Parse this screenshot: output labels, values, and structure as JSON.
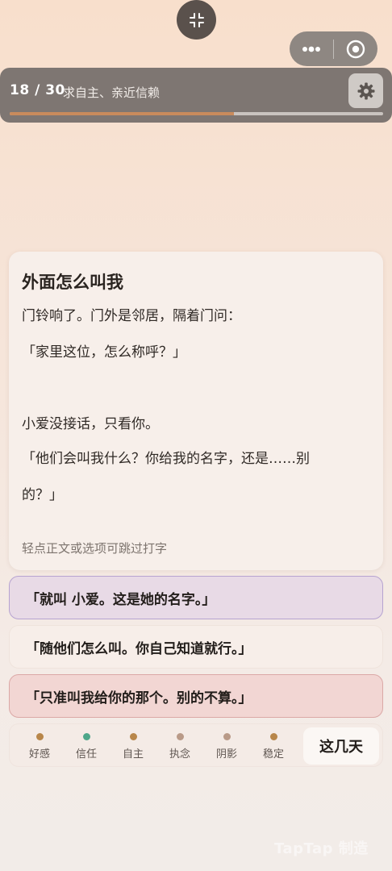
{
  "header": {
    "progress_count": "18 / 30",
    "progress_fraction": 0.6,
    "subtitle": "求自主、亲近信赖"
  },
  "story": {
    "title": "外面怎么叫我",
    "lines": [
      "门铃响了。门外是邻居，隔着门问：",
      "「家里这位，怎么称呼？」",
      "小爱没接话，只看你。",
      "「他们会叫我什么？你给我的名字，还是……别",
      "的？」"
    ],
    "hint": "轻点正文或选项可跳过打字"
  },
  "choices": [
    "「就叫 小爱。这是她的名字。」",
    "「随他们怎么叫。你自己知道就行。」",
    "「只准叫我给你的那个。别的不算。」"
  ],
  "stats": [
    {
      "label": "好感",
      "color": "#b8864a"
    },
    {
      "label": "信任",
      "color": "#4ea78a"
    },
    {
      "label": "自主",
      "color": "#b8864a"
    },
    {
      "label": "执念",
      "color": "#b99a88"
    },
    {
      "label": "阴影",
      "color": "#b99a88"
    },
    {
      "label": "稳定",
      "color": "#b8864a"
    }
  ],
  "days_button": "这几天",
  "watermark": "TapTap 制造"
}
